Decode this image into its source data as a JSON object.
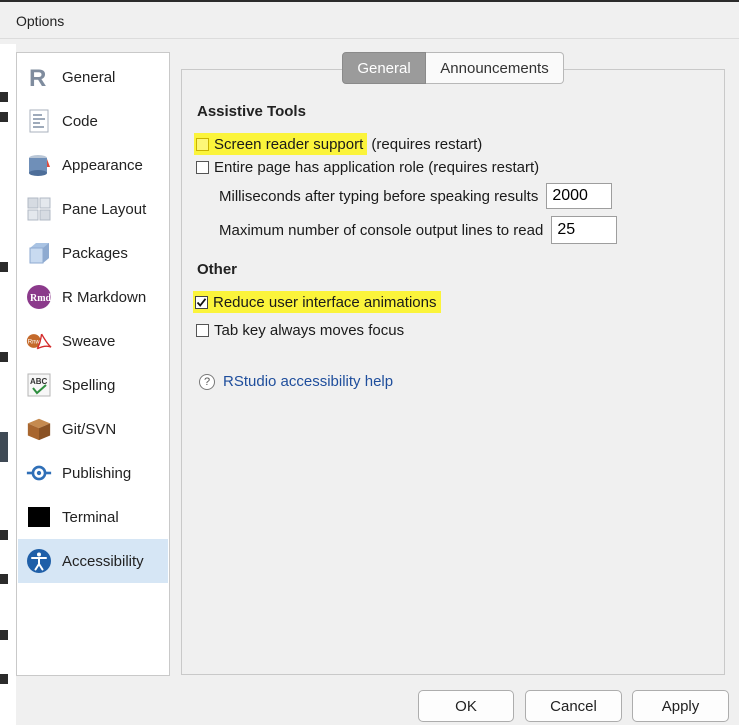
{
  "window": {
    "title": "Options"
  },
  "sidebar": {
    "items": [
      {
        "label": "General",
        "icon": "r-logo-icon"
      },
      {
        "label": "Code",
        "icon": "code-document-icon"
      },
      {
        "label": "Appearance",
        "icon": "paint-bucket-icon"
      },
      {
        "label": "Pane Layout",
        "icon": "pane-layout-icon"
      },
      {
        "label": "Packages",
        "icon": "package-box-icon"
      },
      {
        "label": "R Markdown",
        "icon": "rmd-icon"
      },
      {
        "label": "Sweave",
        "icon": "sweave-pdf-icon"
      },
      {
        "label": "Spelling",
        "icon": "spelling-abc-icon"
      },
      {
        "label": "Git/SVN",
        "icon": "git-box-icon"
      },
      {
        "label": "Publishing",
        "icon": "publishing-icon"
      },
      {
        "label": "Terminal",
        "icon": "terminal-icon"
      },
      {
        "label": "Accessibility",
        "icon": "accessibility-icon"
      }
    ],
    "selected": "Accessibility"
  },
  "tabs": {
    "general": "General",
    "announcements": "Announcements",
    "active": "General"
  },
  "assistive": {
    "heading": "Assistive Tools",
    "screen_reader_label": "Screen reader support",
    "screen_reader_suffix": " (requires restart)",
    "app_role_label": "Entire page has application role (requires restart)",
    "ms_label": "Milliseconds after typing before speaking results",
    "ms_value": "2000",
    "max_lines_label": "Maximum number of console output lines to read",
    "max_lines_value": "25"
  },
  "other": {
    "heading": "Other",
    "reduce_animations_label": "Reduce user interface animations",
    "reduce_animations_checked": true,
    "tab_focus_label": "Tab key always moves focus"
  },
  "help": {
    "link": "RStudio accessibility help"
  },
  "buttons": {
    "ok": "OK",
    "cancel": "Cancel",
    "apply": "Apply"
  },
  "colors": {
    "highlight": "#fbf43b",
    "selected_row": "#d6e6f5",
    "link": "#1f4e9c",
    "active_tab": "#9b9b9b"
  }
}
